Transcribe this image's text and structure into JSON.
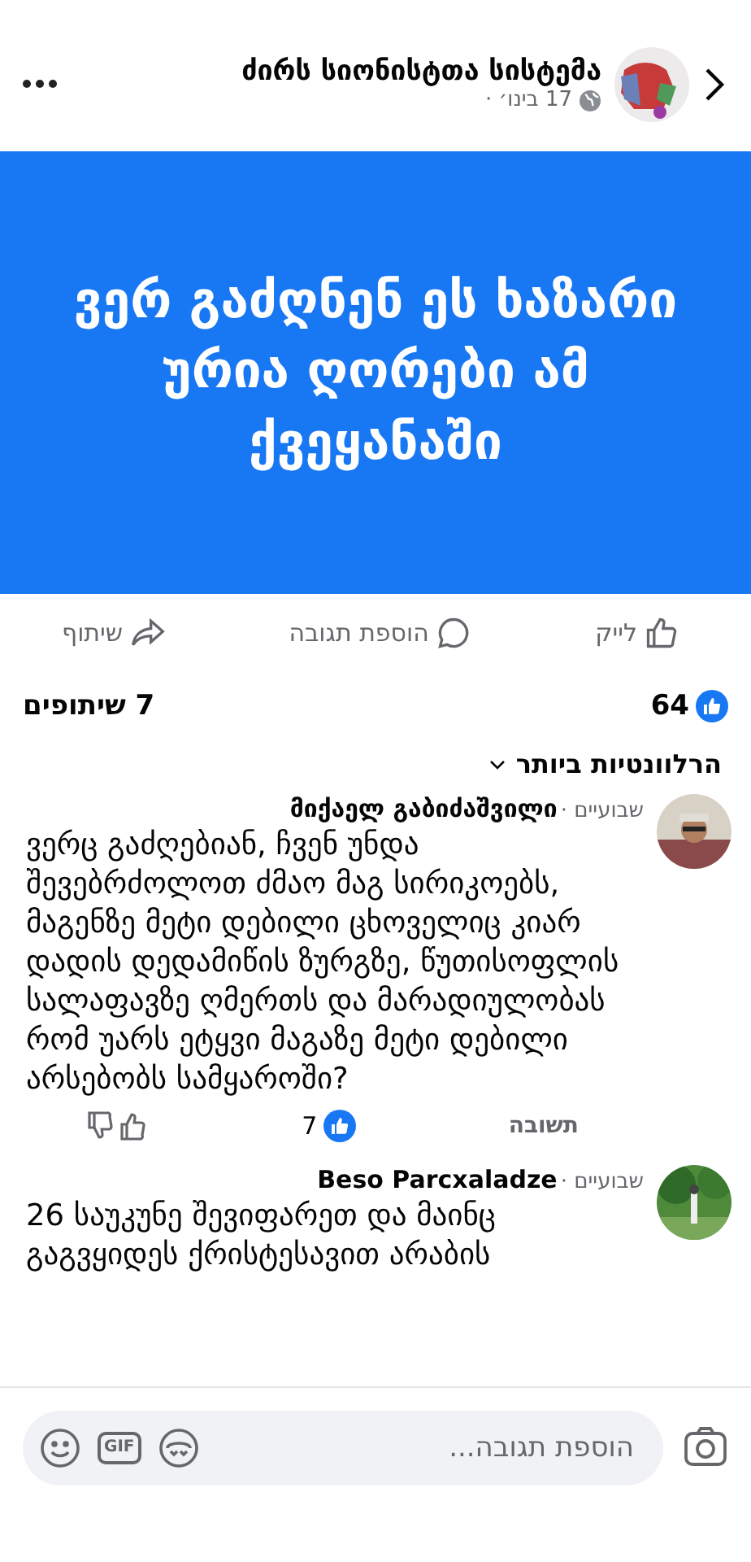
{
  "header": {
    "page_name": "ძირს სიონისტთა სისტემა",
    "date": "17 בינו׳ ·"
  },
  "post": {
    "text": "ვერ გაძღნენ ეს ხაზარი ურია ღორები ამ ქვეყანაში"
  },
  "actions": [
    {
      "kind": "like",
      "label": "לייק"
    },
    {
      "kind": "comment",
      "label": "הוספת תגובה"
    },
    {
      "kind": "share",
      "label": "שיתוף"
    }
  ],
  "stats": {
    "reactions": "64",
    "shares": "7 שיתופים"
  },
  "sort": {
    "label": "הרלוונטיות ביותר"
  },
  "comments": [
    {
      "author": "მიქაელ გაბიძაშვილი",
      "time": "שבועיים ·",
      "text": "ვერც გაძღებიან, ჩვენ უნდა შევებრძოლოთ ძმაო მაგ სირიკოებს, მაგენზე მეტი დებილი ცხოველიც კიარ დადის დედამიწის ზურგზე, წუთისოფლის სალაფავზე ღმერთს და მარადიულობას რომ უარს ეტყვი მაგაზე მეტი დებილი არსებობს სამყაროში?",
      "reply": "תשובה",
      "likes": "7"
    },
    {
      "author": "Beso Parcxaladze",
      "time": "שבועיים ·",
      "text": "26  საუკუნე შევიფარეთ  და მაინც გაგვყიდეს ქრისტესავით არაბის"
    }
  ],
  "composer": {
    "placeholder": "הוספת תגובה...",
    "gif": "GIF"
  }
}
